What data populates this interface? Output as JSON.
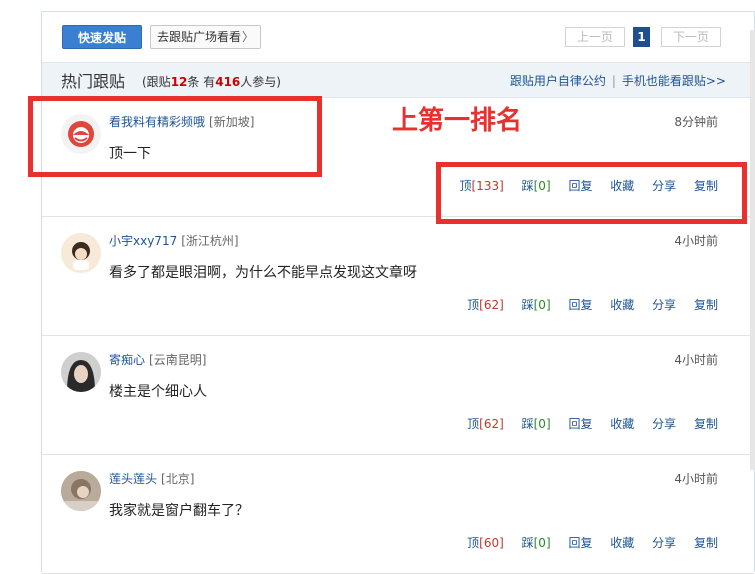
{
  "topbar": {
    "post_button": "快速发贴",
    "square_button": "去跟贴广场看看",
    "square_chevron": "〉",
    "prev_page": "上一页",
    "current_page": "1",
    "next_page": "下一页"
  },
  "hot": {
    "title": "热门跟贴",
    "stats_prefix": "(跟贴",
    "reply_count": "12",
    "stats_mid": "条 有",
    "participant_count": "416",
    "stats_suffix": "人参与)",
    "link_rules": "跟贴用户自律公约",
    "link_mobile": "手机也能看跟贴>>"
  },
  "annotation": {
    "text": "上第一排名",
    "color": "#e8312f"
  },
  "action_labels": {
    "up": "顶",
    "down": "踩",
    "reply": "回复",
    "fav": "收藏",
    "share": "分享",
    "copy": "复制"
  },
  "posts": [
    {
      "user": "看我料有精彩频哦",
      "location": "[新加坡]",
      "time": "8分钟前",
      "content": "顶一下",
      "up": "[133]",
      "down": "[0]",
      "avatar_icon": "netease-logo-icon"
    },
    {
      "user": "小宇xxy717",
      "location": "[浙江杭州]",
      "time": "4小时前",
      "content": "看多了都是眼泪啊，为什么不能早点发现这文章呀",
      "up": "[62]",
      "down": "[0]",
      "avatar_icon": "cartoon-girl-avatar"
    },
    {
      "user": "寄痴心",
      "location": "[云南昆明]",
      "time": "4小时前",
      "content": "楼主是个细心人",
      "up": "[62]",
      "down": "[0]",
      "avatar_icon": "portrait-avatar"
    },
    {
      "user": "莲头莲头",
      "location": "[北京]",
      "time": "4小时前",
      "content": "我家就是窗户翻车了？",
      "up": "[60]",
      "down": "[0]",
      "avatar_icon": "photo-avatar"
    }
  ]
}
